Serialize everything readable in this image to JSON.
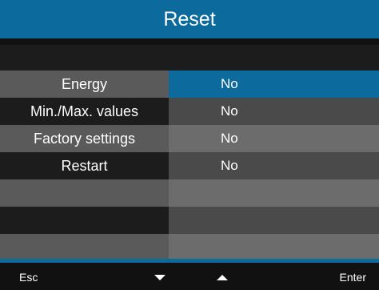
{
  "header": {
    "title": "Reset"
  },
  "menu": {
    "rows": [
      {
        "label": "Energy",
        "value": "No"
      },
      {
        "label": "Min./Max. values",
        "value": "No"
      },
      {
        "label": "Factory settings",
        "value": "No"
      },
      {
        "label": "Restart",
        "value": "No"
      }
    ],
    "selected_index": 0
  },
  "footer": {
    "esc_label": "Esc",
    "enter_label": "Enter",
    "down_icon": "triangle-down-icon",
    "up_icon": "triangle-up-icon"
  },
  "colors": {
    "accent": "#0d6a9c",
    "background": "#111111"
  }
}
